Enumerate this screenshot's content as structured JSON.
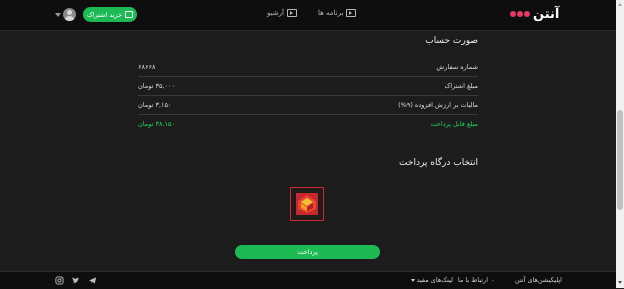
{
  "header": {
    "logo_text": "آنتن",
    "nav": [
      {
        "label": "برنامه ها",
        "icon": "play-box-icon"
      },
      {
        "label": "آرشیو",
        "icon": "play-box-icon"
      }
    ],
    "subscribe_label": "خرید اشتراک",
    "accent_color": "#1db954",
    "brand_color": "#e63a62"
  },
  "invoice": {
    "title": "صورت حساب",
    "rows": [
      {
        "label": "شماره سفارش",
        "value": "۶۸۶۶۸"
      },
      {
        "label": "مبلغ اشتراک",
        "value": "۳۵,۰۰۰ تومان"
      },
      {
        "label": "مالیات بر ارزش افزوده (۹%)",
        "value": "۳,۱۵۰ تومان"
      },
      {
        "label": "مبلغ قابل پرداخت",
        "value": "۳۸,۱۵۰ تومان"
      }
    ]
  },
  "gateway": {
    "title": "انتخاب درگاه پرداخت",
    "selected_icon": "bank-logo-icon"
  },
  "pay_button_label": "پرداخت",
  "footer": {
    "apps_label": "اپلیکیشن‌های آنتن",
    "contact_label": "ارتباط با ما",
    "useful_links_label": "لینک‌های مفید",
    "social": [
      "telegram-icon",
      "twitter-icon",
      "instagram-icon"
    ]
  }
}
